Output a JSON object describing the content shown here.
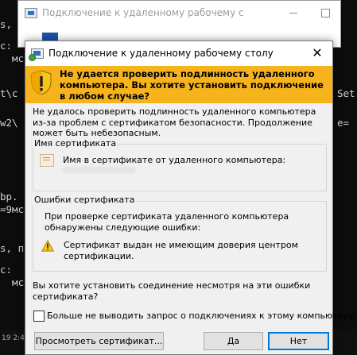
{
  "terminal": {
    "lines": [
      {
        "text": "s, п"
      },
      {
        "text": "c:"
      },
      {
        "text": "  мс"
      },
      {
        "text": "t\\c"
      },
      {
        "text": "w2\\"
      },
      {
        "text": "Set"
      },
      {
        "text": "e="
      },
      {
        "text": "bp."
      },
      {
        "text": "=9мс"
      },
      {
        "text": "s, п"
      },
      {
        "text": "c:"
      },
      {
        "text": "  мс"
      }
    ]
  },
  "taskbar": {
    "clock": "19 2:4"
  },
  "background_window": {
    "title": "Подключение к удаленному рабочему с"
  },
  "dialog": {
    "title": "Подключение к удаленному рабочему столу",
    "close_glyph": "✕",
    "banner_text": "Не удается проверить подлинность удаленного компьютера. Вы хотите установить подключение в любом случае?",
    "description": "Не удалось проверить подлинность удаленного компьютера из-за проблем с сертификатом безопасности. Продолжение может быть небезопасным.",
    "cert_group_label": "Имя сертификата",
    "cert_name_label": "Имя в сертификате от удаленного компьютера:",
    "errors_group_label": "Ошибки сертификата",
    "errors_intro": "При проверке сертификата удаленного компьютера обнаружены следующие ошибки:",
    "error_item": "Сертификат выдан не имеющим доверия центром сертификации.",
    "question": "Вы хотите установить соединение несмотря на эти ошибки сертификата?",
    "checkbox_label": "Больше не выводить запрос о подключениях к этому компьютеру",
    "checkbox_checked": false,
    "buttons": {
      "view_cert": "Просмотреть сертификат...",
      "yes": "Да",
      "no": "Нет"
    },
    "colors": {
      "banner": "#f7b31c",
      "default_button_border": "#0078d7"
    }
  }
}
